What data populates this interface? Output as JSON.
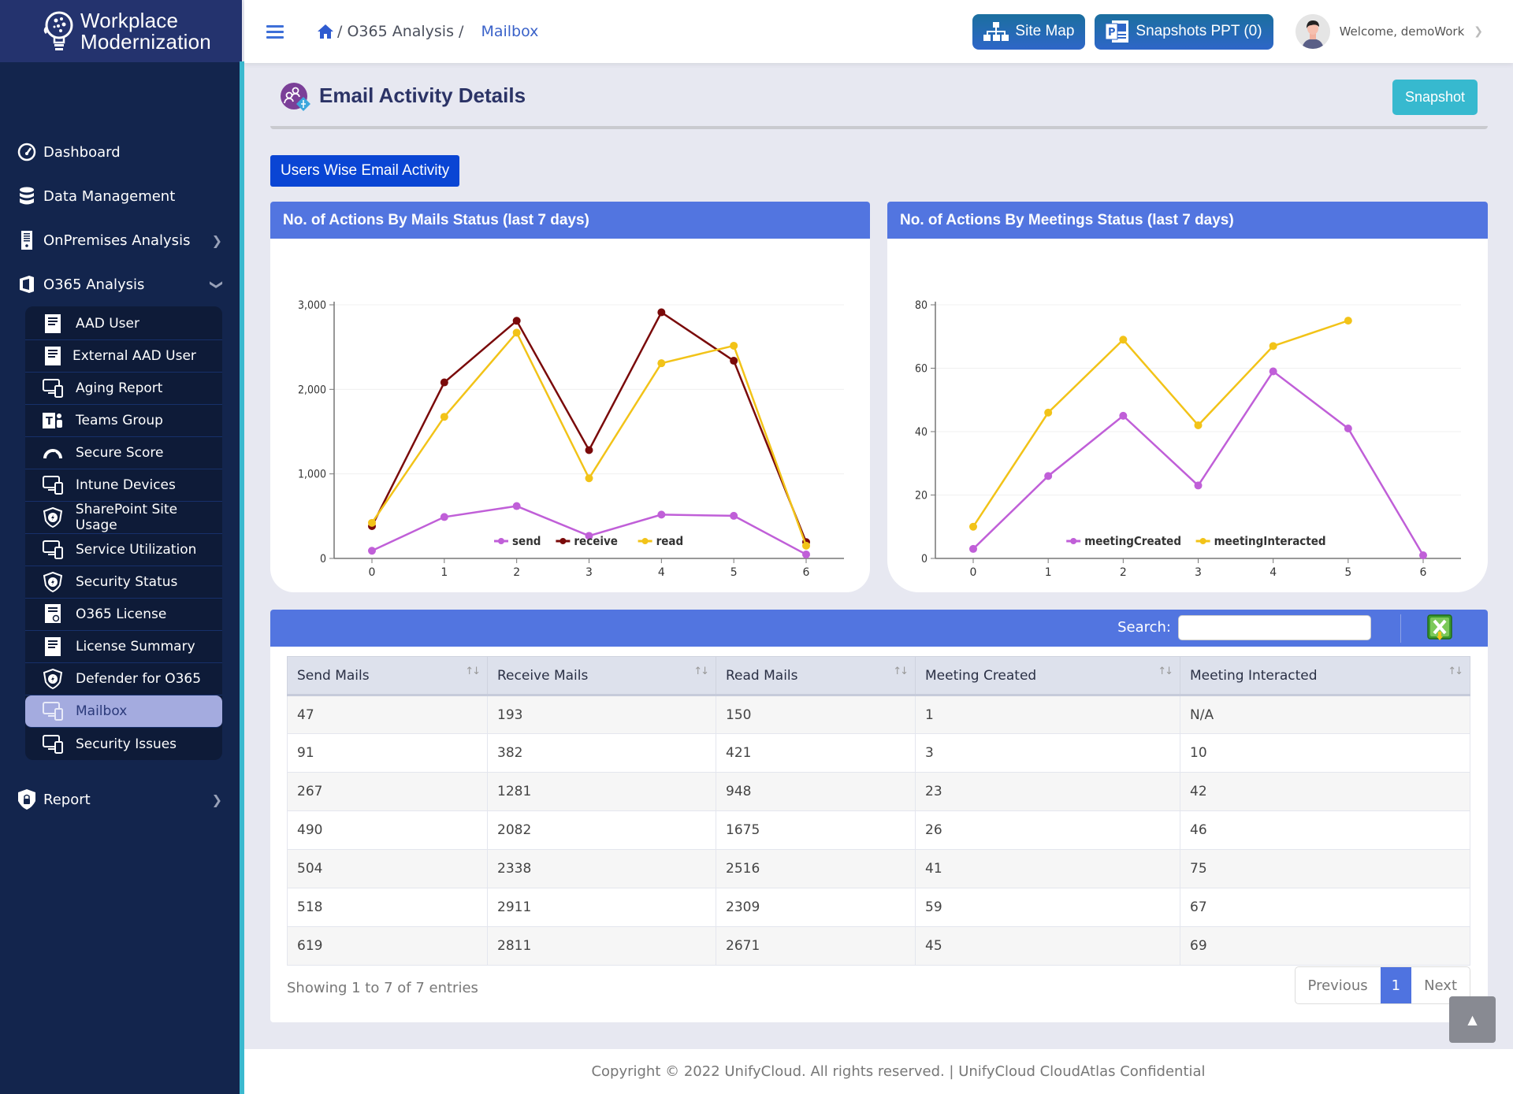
{
  "brand": {
    "line1": "Workplace",
    "line2": "Modernization"
  },
  "sidebar": {
    "items": [
      {
        "label": "Dashboard",
        "icon": "dashboard-icon"
      },
      {
        "label": "Data Management",
        "icon": "database-icon"
      },
      {
        "label": "OnPremises Analysis",
        "icon": "server-icon",
        "chevron": "right"
      },
      {
        "label": "O365 Analysis",
        "icon": "office-icon",
        "chevron": "down"
      }
    ],
    "submenu": [
      {
        "label": "AAD User",
        "icon": "document-icon"
      },
      {
        "label": "External AAD User",
        "icon": "document-icon"
      },
      {
        "label": "Aging Report",
        "icon": "devices-icon"
      },
      {
        "label": "Teams Group",
        "icon": "teams-icon"
      },
      {
        "label": "Secure Score",
        "icon": "gauge-icon"
      },
      {
        "label": "Intune Devices",
        "icon": "devices-icon"
      },
      {
        "label": "SharePoint Site Usage",
        "icon": "shield-icon"
      },
      {
        "label": "Service Utilization",
        "icon": "devices-icon"
      },
      {
        "label": "Security Status",
        "icon": "shield-icon"
      },
      {
        "label": "O365 License",
        "icon": "certificate-icon"
      },
      {
        "label": "License Summary",
        "icon": "document-icon"
      },
      {
        "label": "Defender for O365",
        "icon": "shield-icon"
      },
      {
        "label": "Mailbox",
        "icon": "devices-icon",
        "active": true
      },
      {
        "label": "Security Issues",
        "icon": "devices-icon"
      }
    ],
    "report": {
      "label": "Report",
      "icon": "lock-shield-icon"
    }
  },
  "topbar": {
    "breadcrumb": {
      "section": "/ O365 Analysis /",
      "current": "Mailbox"
    },
    "site_map": "Site Map",
    "snapshots_ppt": "Snapshots PPT (0)",
    "welcome": "Welcome, demoWork"
  },
  "page": {
    "title": "Email Activity Details",
    "snapshot_button": "Snapshot",
    "users_wise_button": "Users Wise Email Activity"
  },
  "colors": {
    "send": "#c05fd8",
    "receive": "#7a0a0a",
    "read": "#f2c318",
    "meetingCreated": "#c05fd8",
    "meetingInteracted": "#f2c318",
    "card_header": "#5275e0"
  },
  "chart_data": [
    {
      "type": "line",
      "title": "No. of Actions By Mails Status (last 7 days)",
      "x": [
        0,
        1,
        2,
        3,
        4,
        5,
        6
      ],
      "xlabel": "",
      "ylabel": "",
      "ylim": [
        0,
        3000
      ],
      "yticks": [
        0,
        1000,
        2000,
        3000
      ],
      "ytick_labels": [
        "0",
        "1,000",
        "2,000",
        "3,000"
      ],
      "grid": true,
      "legend": "bottom",
      "series": [
        {
          "name": "send",
          "values": [
            91,
            490,
            619,
            267,
            518,
            504,
            47
          ]
        },
        {
          "name": "receive",
          "values": [
            382,
            2082,
            2811,
            1281,
            2911,
            2338,
            193
          ]
        },
        {
          "name": "read",
          "values": [
            421,
            1675,
            2671,
            948,
            2309,
            2516,
            150
          ]
        }
      ]
    },
    {
      "type": "line",
      "title": "No. of Actions By Meetings Status (last 7 days)",
      "x": [
        0,
        1,
        2,
        3,
        4,
        5,
        6
      ],
      "xlabel": "",
      "ylabel": "",
      "ylim": [
        0,
        80
      ],
      "yticks": [
        0,
        20,
        40,
        60,
        80
      ],
      "ytick_labels": [
        "0",
        "20",
        "40",
        "60",
        "80"
      ],
      "grid": true,
      "legend": "bottom",
      "series": [
        {
          "name": "meetingCreated",
          "values": [
            3,
            26,
            45,
            23,
            59,
            41,
            1
          ]
        },
        {
          "name": "meetingInteracted",
          "values": [
            10,
            46,
            69,
            42,
            67,
            75,
            null
          ]
        }
      ]
    }
  ],
  "table": {
    "search_label": "Search:",
    "search_value": "",
    "columns": [
      "Send Mails",
      "Receive Mails",
      "Read Mails",
      "Meeting Created",
      "Meeting Interacted"
    ],
    "rows": [
      [
        "47",
        "193",
        "150",
        "1",
        "N/A"
      ],
      [
        "91",
        "382",
        "421",
        "3",
        "10"
      ],
      [
        "267",
        "1281",
        "948",
        "23",
        "42"
      ],
      [
        "490",
        "2082",
        "1675",
        "26",
        "46"
      ],
      [
        "504",
        "2338",
        "2516",
        "41",
        "75"
      ],
      [
        "518",
        "2911",
        "2309",
        "59",
        "67"
      ],
      [
        "619",
        "2811",
        "2671",
        "45",
        "69"
      ]
    ],
    "info": "Showing 1 to 7 of 7 entries",
    "pager": {
      "previous": "Previous",
      "current": "1",
      "next": "Next"
    }
  },
  "footer": "Copyright © 2022 UnifyCloud. All rights reserved.  |  UnifyCloud CloudAtlas Confidential"
}
